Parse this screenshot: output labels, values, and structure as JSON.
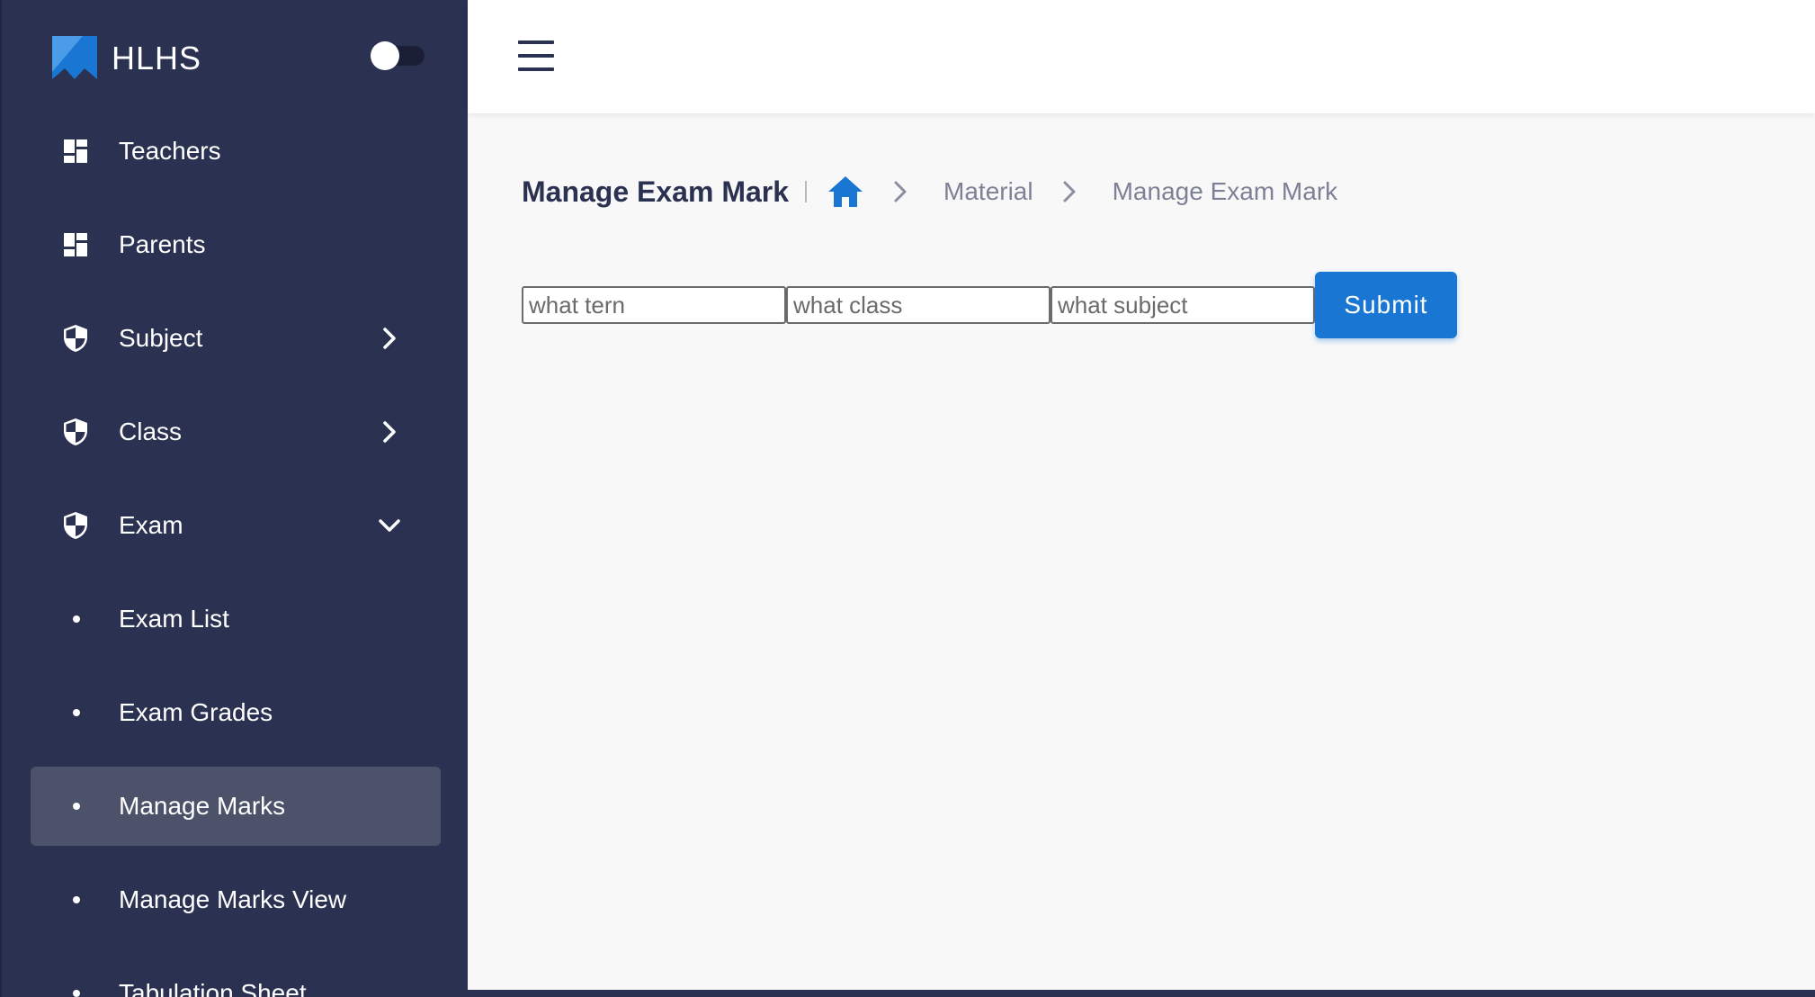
{
  "brand": {
    "name": "HLHS",
    "logo_icon": "brand-logo-icon",
    "accent": "#1976d2"
  },
  "theme_toggle": {
    "state": "off"
  },
  "sidebar": {
    "items": [
      {
        "label": "Teachers",
        "icon": "dashboard-icon"
      },
      {
        "label": "Parents",
        "icon": "dashboard-icon"
      },
      {
        "label": "Subject",
        "icon": "shield-icon",
        "chevron": "chevron-right-icon"
      },
      {
        "label": "Class",
        "icon": "shield-icon",
        "chevron": "chevron-right-icon"
      },
      {
        "label": "Exam",
        "icon": "shield-icon",
        "chevron": "chevron-down-icon"
      },
      {
        "label": "Exam List",
        "icon": "bullet-icon"
      },
      {
        "label": "Exam Grades",
        "icon": "bullet-icon"
      },
      {
        "label": "Manage Marks",
        "icon": "bullet-icon",
        "active": true
      },
      {
        "label": "Manage Marks View",
        "icon": "bullet-icon"
      },
      {
        "label": "Tabulation Sheet",
        "icon": "bullet-icon"
      }
    ],
    "colors": {
      "background": "#2b3150",
      "active": "#4c5269"
    }
  },
  "topbar": {
    "menu_icon": "hamburger-menu-icon"
  },
  "page": {
    "title": "Manage Exam Mark",
    "breadcrumb": {
      "home_icon": "home-icon",
      "items": [
        "Material",
        "Manage Exam Mark"
      ]
    }
  },
  "form": {
    "term_placeholder": "what tern",
    "class_placeholder": "what class",
    "subject_placeholder": "what subject",
    "term_value": "",
    "class_value": "",
    "subject_value": "",
    "submit_label": "Submit"
  }
}
